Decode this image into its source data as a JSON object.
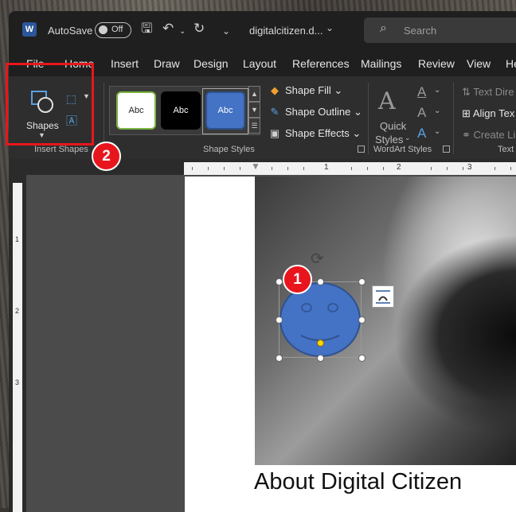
{
  "titlebar": {
    "app_icon_letter": "W",
    "autosave_label": "AutoSave",
    "autosave_state": "Off",
    "doc_name": "digitalcitizen.d...",
    "search_placeholder": "Search"
  },
  "tabs": [
    "File",
    "Home",
    "Insert",
    "Draw",
    "Design",
    "Layout",
    "References",
    "Mailings",
    "Review",
    "View",
    "He"
  ],
  "ribbon": {
    "insert_shapes": {
      "shapes_label": "Shapes",
      "group_label": "Insert Shapes"
    },
    "shape_styles": {
      "samples": [
        "Abc",
        "Abc",
        "Abc"
      ],
      "shape_fill": "Shape Fill",
      "shape_outline": "Shape Outline",
      "shape_effects": "Shape Effects",
      "group_label": "Shape Styles"
    },
    "wordart": {
      "quick_styles": "Quick",
      "quick_styles_2": "Styles",
      "group_label": "WordArt Styles"
    },
    "text": {
      "text_direction": "Text Dire",
      "align_text": "Align Tex",
      "create_link": "Create Li",
      "group_label": "Text"
    }
  },
  "ruler": {
    "top_numbers": [
      "1",
      "2",
      "3"
    ],
    "left_numbers": [
      "1",
      "2",
      "3"
    ]
  },
  "document": {
    "heading": "About Digital Citizen"
  },
  "annotations": {
    "badge_1": "1",
    "badge_2": "2"
  },
  "colors": {
    "accent_red": "#e8161c",
    "shape_fill": "#4472c4",
    "word_blue": "#2b579a"
  }
}
